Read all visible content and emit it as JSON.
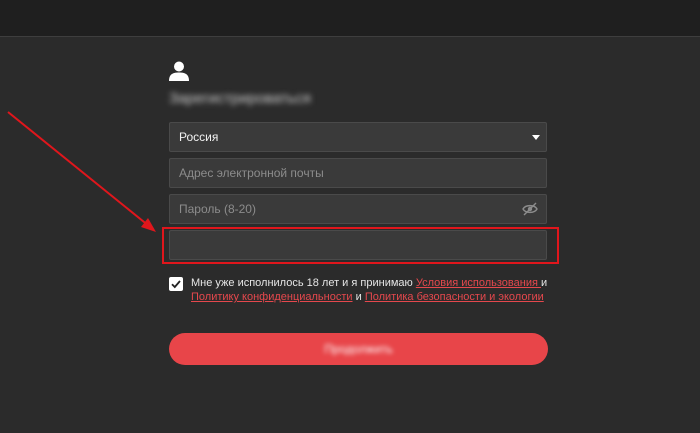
{
  "header": {},
  "form": {
    "title": "Зарегистрироваться",
    "country": {
      "value": "Россия"
    },
    "email": {
      "placeholder": "Адрес электронной почты"
    },
    "password": {
      "placeholder": "Пароль (8-20)"
    },
    "extra_field": {
      "value": ""
    },
    "agreement": {
      "checked": true,
      "text_before": "Мне уже исполнилось 18 лет и я принимаю ",
      "link_terms": "Условия использования ",
      "text_and1": "и",
      "link_privacy": "Политику конфиденциальности",
      "text_and2": " и ",
      "link_security": "Политика безопасности и экологии"
    },
    "submit_label": "Продолжить"
  },
  "annotation": {
    "color": "#e0161c"
  },
  "colors": {
    "accent": "#e84549",
    "background": "#2b2b2b"
  }
}
